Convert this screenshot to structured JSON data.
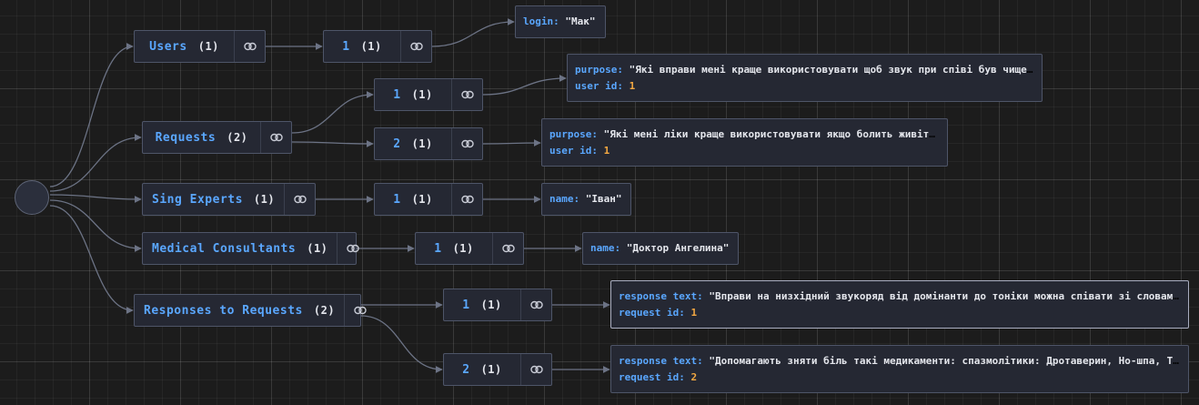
{
  "colors": {
    "key": "#5aa7ff",
    "string": "#e4e6ec",
    "number": "#f3a842",
    "edge": "#6c7385",
    "node_bg": "#252833"
  },
  "icons": {
    "link": "link-icon"
  },
  "collections": [
    {
      "label": "Users",
      "count": "(1)"
    },
    {
      "label": "Requests",
      "count": "(2)"
    },
    {
      "label": "Sing Experts",
      "count": "(1)"
    },
    {
      "label": "Medical Consultants",
      "count": "(1)"
    },
    {
      "label": "Responses to Requests",
      "count": "(2)"
    }
  ],
  "items": [
    {
      "label": "1",
      "count": "(1)"
    },
    {
      "label": "1",
      "count": "(1)"
    },
    {
      "label": "2",
      "count": "(1)"
    },
    {
      "label": "1",
      "count": "(1)"
    },
    {
      "label": "1",
      "count": "(1)"
    },
    {
      "label": "1",
      "count": "(1)"
    },
    {
      "label": "2",
      "count": "(1)"
    }
  ],
  "values": [
    {
      "fields": [
        {
          "key": "login:",
          "value": "\"Мак\"",
          "type": "string"
        }
      ]
    },
    {
      "fields": [
        {
          "key": "purpose:",
          "value": "\"Які вправи мені краще використовувати щоб звук при співі був чище?\"",
          "type": "string"
        },
        {
          "key": "user id:",
          "value": "1",
          "type": "number"
        }
      ]
    },
    {
      "fields": [
        {
          "key": "purpose:",
          "value": "\"Які мені ліки краще використовувати якщо болить живіт?\"",
          "type": "string"
        },
        {
          "key": "user id:",
          "value": "1",
          "type": "number"
        }
      ]
    },
    {
      "fields": [
        {
          "key": "name:",
          "value": "\"Іван\"",
          "type": "string"
        }
      ]
    },
    {
      "fields": [
        {
          "key": "name:",
          "value": "\"Доктор Ангелина\"",
          "type": "string"
        }
      ]
    },
    {
      "fields": [
        {
          "key": "response text:",
          "value": "\"Вправи на низхідний звукоряд від домінанти до тоніки можна співати зі словами…",
          "type": "string"
        },
        {
          "key": "request id:",
          "value": "1",
          "type": "number"
        }
      ]
    },
    {
      "fields": [
        {
          "key": "response text:",
          "value": "\"Допомагають зняти біль такі медикаменти: спазмолітики: Дротаверин, Но-шпа, Тр…",
          "type": "string"
        },
        {
          "key": "request id:",
          "value": "2",
          "type": "number"
        }
      ]
    }
  ]
}
